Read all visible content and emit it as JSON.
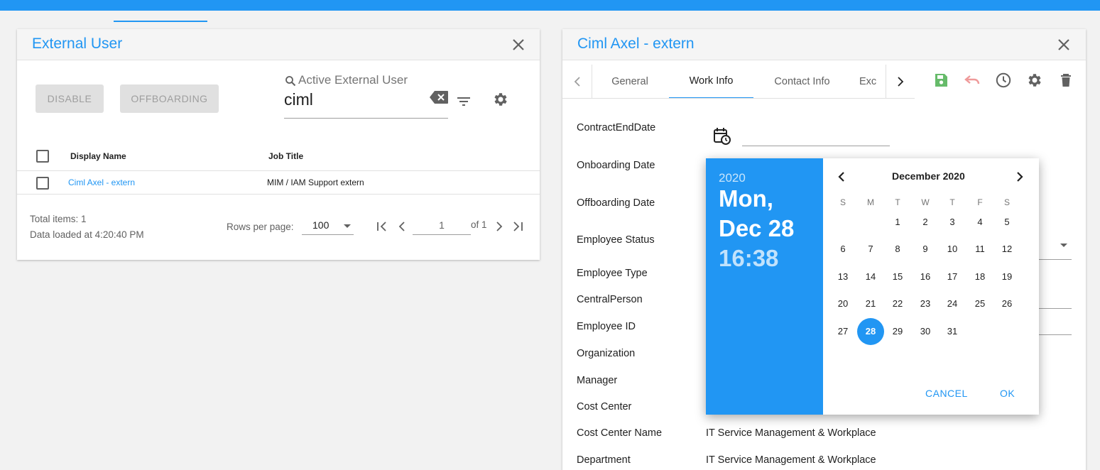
{
  "left_panel": {
    "title": "External User",
    "buttons": {
      "disable": "DISABLE",
      "offboarding": "OFFBOARDING"
    },
    "search": {
      "label": "Active External User",
      "value": "ciml"
    },
    "table": {
      "headers": [
        "Display Name",
        "Job Title"
      ],
      "rows": [
        {
          "display_name": "Ciml Axel - extern",
          "job_title": "MIM / IAM Support extern"
        }
      ]
    },
    "footer": {
      "total_items": "Total items: 1",
      "data_loaded": "Data loaded at 4:20:40 PM",
      "rows_per_page_label": "Rows per page:",
      "rows_per_page_value": "100",
      "page_value": "1",
      "page_of": "of 1"
    }
  },
  "right_panel": {
    "title": "Ciml Axel - extern",
    "tabs": [
      "General",
      "Work Info",
      "Contact Info",
      "Exc"
    ],
    "active_tab": "Work Info",
    "fields": [
      {
        "label": "ContractEndDate",
        "value": ""
      },
      {
        "label": "Onboarding Date",
        "value": ""
      },
      {
        "label": "Offboarding Date",
        "value": ""
      },
      {
        "label": "Employee Status",
        "value": ""
      },
      {
        "label": "Employee Type",
        "value": ""
      },
      {
        "label": "CentralPerson",
        "value": ""
      },
      {
        "label": "Employee ID",
        "value": ""
      },
      {
        "label": "Organization",
        "value": ""
      },
      {
        "label": "Manager",
        "value": ""
      },
      {
        "label": "Cost Center",
        "value": ""
      },
      {
        "label": "Cost Center Name",
        "value": "IT Service Management & Workplace"
      },
      {
        "label": "Department",
        "value": "IT Service Management & Workplace"
      }
    ]
  },
  "date_picker": {
    "year": "2020",
    "weekday_label": "Mon,",
    "date_label": "Dec 28",
    "time_label": "16:38",
    "month_title": "December 2020",
    "weekdays": [
      "S",
      "M",
      "T",
      "W",
      "T",
      "F",
      "S"
    ],
    "weeks": [
      [
        "",
        "",
        "1",
        "2",
        "3",
        "4",
        "5"
      ],
      [
        "6",
        "7",
        "8",
        "9",
        "10",
        "11",
        "12"
      ],
      [
        "13",
        "14",
        "15",
        "16",
        "17",
        "18",
        "19"
      ],
      [
        "20",
        "21",
        "22",
        "23",
        "24",
        "25",
        "26"
      ],
      [
        "27",
        "28",
        "29",
        "30",
        "31",
        "",
        ""
      ]
    ],
    "selected_day": "28",
    "cancel": "CANCEL",
    "ok": "OK"
  },
  "colors": {
    "primary": "#2196f3",
    "save": "#66bb6a",
    "undo": "#ef9a9a"
  }
}
